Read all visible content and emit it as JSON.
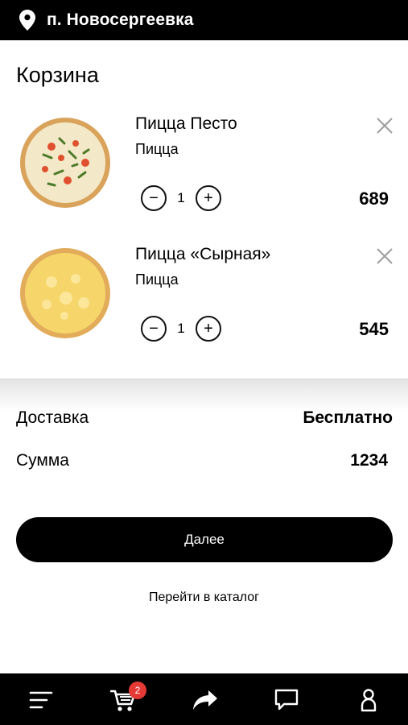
{
  "header": {
    "city": "п. Новосергеевка",
    "location_icon": "location-pin-icon"
  },
  "page_title": "Корзина",
  "items": [
    {
      "name": "Пицца Песто",
      "category": "Пицца",
      "quantity": "1",
      "price": "689",
      "minus": "−",
      "plus": "+"
    },
    {
      "name": "Пицца «Сырная»",
      "category": "Пицца",
      "quantity": "1",
      "price": "545",
      "minus": "−",
      "plus": "+"
    }
  ],
  "summary": {
    "delivery_label": "Доставка",
    "delivery_value": "Бесплатно",
    "total_label": "Сумма",
    "total_value": "1234"
  },
  "next_button": "Далее",
  "catalog_link": "Перейти в каталог",
  "bottom_nav": {
    "cart_badge": "2",
    "icons": [
      "menu-icon",
      "cart-icon",
      "share-icon",
      "chat-icon",
      "profile-icon"
    ]
  },
  "colors": {
    "badge": "#e53935",
    "bar": "#000000"
  }
}
